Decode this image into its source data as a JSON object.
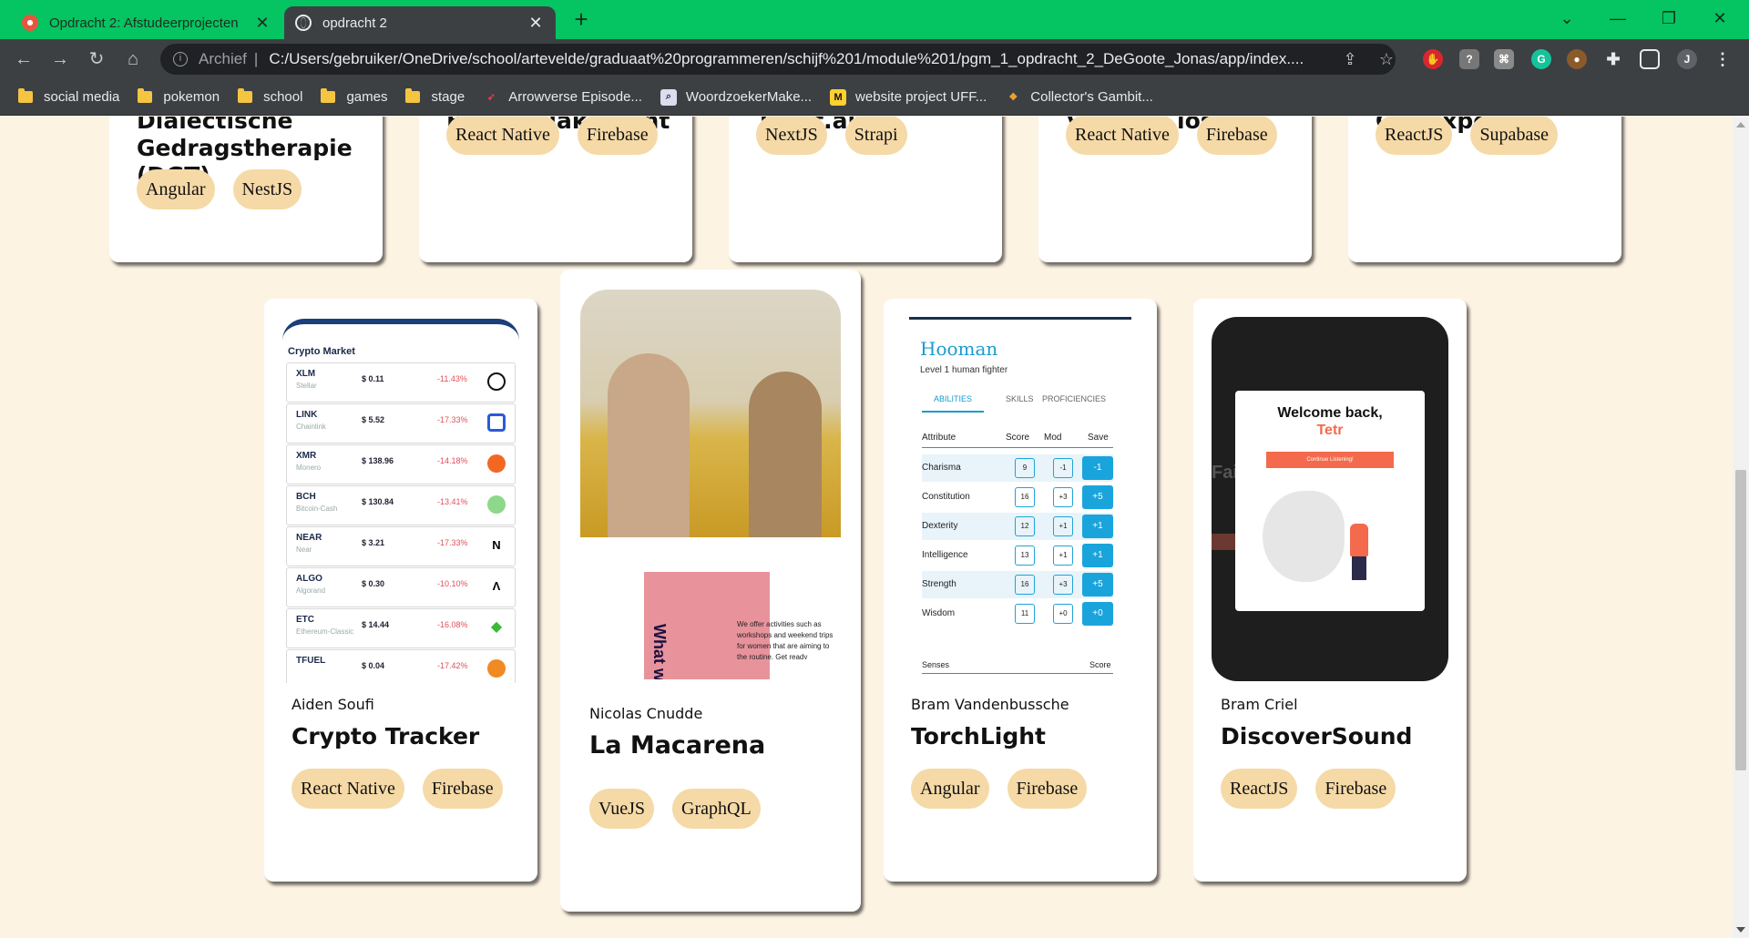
{
  "browser": {
    "tabs": [
      {
        "title": "Opdracht 2: Afstudeerprojecten",
        "active": false
      },
      {
        "title": "opdracht 2",
        "active": true
      }
    ],
    "address": {
      "label": "Archief",
      "url": "C:/Users/gebruiker/OneDrive/school/artevelde/graduaat%20programmeren/schijf%201/module%201/pgm_1_opdracht_2_DeGoote_Jonas/app/index...."
    },
    "profile_initial": "J",
    "bookmarks": [
      {
        "label": "social media",
        "icon": "folder-icon"
      },
      {
        "label": "pokemon",
        "icon": "folder-icon"
      },
      {
        "label": "school",
        "icon": "folder-icon"
      },
      {
        "label": "games",
        "icon": "folder-icon"
      },
      {
        "label": "stage",
        "icon": "folder-icon"
      },
      {
        "label": "Arrowverse Episode...",
        "icon": "arrowverse-icon"
      },
      {
        "label": "WoordzoekerMake...",
        "icon": "magnifier-icon"
      },
      {
        "label": "website project UFF...",
        "icon": "miro-icon"
      },
      {
        "label": "Collector's Gambit...",
        "icon": "collector-icon"
      }
    ]
  },
  "top_cards": [
    {
      "title": "Dialectische Gedragstherapie (DGT)",
      "tags": [
        "Angular",
        "NestJS"
      ]
    },
    {
      "title": "Buurtkajaks Gent",
      "tags": [
        "React Native",
        "Firebase"
      ]
    },
    {
      "title": "Tekst.ai",
      "tags": [
        "NextJS",
        "Strapi"
      ]
    },
    {
      "title": "Virtual Closet",
      "tags": [
        "React Native",
        "Firebase"
      ]
    },
    {
      "title": "Car expense",
      "tags": [
        "ReactJS",
        "Supabase"
      ]
    }
  ],
  "bottom_cards": [
    {
      "author": "Aiden Soufi",
      "title": "Crypto Tracker",
      "tags": [
        "React Native",
        "Firebase"
      ]
    },
    {
      "author": "Nicolas Cnudde",
      "title": "La Macarena",
      "tags": [
        "VueJS",
        "GraphQL"
      ]
    },
    {
      "author": "Bram Vandenbussche",
      "title": "TorchLight",
      "tags": [
        "Angular",
        "Firebase"
      ]
    },
    {
      "author": "Bram Criel",
      "title": "DiscoverSound",
      "tags": [
        "ReactJS",
        "Firebase"
      ]
    }
  ],
  "crypto": {
    "header": "Crypto Market",
    "rows": [
      {
        "sym": "XLM",
        "name": "Stellar",
        "price": "$ 0.11",
        "change": "-11.43%",
        "color": "#111111"
      },
      {
        "sym": "LINK",
        "name": "Chainlink",
        "price": "$ 5.52",
        "change": "-17.33%",
        "color": "#2a5ada"
      },
      {
        "sym": "XMR",
        "name": "Monero",
        "price": "$ 138.96",
        "change": "-14.18%",
        "color": "#f26822"
      },
      {
        "sym": "BCH",
        "name": "Bitcoin-Cash",
        "price": "$ 130.84",
        "change": "-13.41%",
        "color": "#4cc947"
      },
      {
        "sym": "NEAR",
        "name": "Near",
        "price": "$ 3.21",
        "change": "-17.33%",
        "color": "#111111"
      },
      {
        "sym": "ALGO",
        "name": "Algorand",
        "price": "$ 0.30",
        "change": "-10.10%",
        "color": "#111111"
      },
      {
        "sym": "ETC",
        "name": "Ethereum-Classic",
        "price": "$ 14.44",
        "change": "-16.08%",
        "color": "#3ab83a"
      },
      {
        "sym": "TFUEL",
        "name": "",
        "price": "$ 0.04",
        "change": "-17.42%",
        "color": "#f08a24"
      }
    ]
  },
  "macarena": {
    "vertical_text": "What w",
    "body": "We offer activities such as workshops and weekend trips for women that are aiming to the routine. Get ready"
  },
  "hooman": {
    "name": "Hooman",
    "subtitle": "Level 1 human fighter",
    "tabs": [
      "ABILITIES",
      "SKILLS",
      "PROFICIENCIES"
    ],
    "headers": [
      "Attribute",
      "Score",
      "Mod",
      "Save"
    ],
    "rows": [
      {
        "attr": "Charisma",
        "score": "9",
        "mod": "-1",
        "save": "-1"
      },
      {
        "attr": "Constitution",
        "score": "16",
        "mod": "+3",
        "save": "+5"
      },
      {
        "attr": "Dexterity",
        "score": "12",
        "mod": "+1",
        "save": "+1"
      },
      {
        "attr": "Intelligence",
        "score": "13",
        "mod": "+1",
        "save": "+1"
      },
      {
        "attr": "Strength",
        "score": "16",
        "mod": "+3",
        "save": "+5"
      },
      {
        "attr": "Wisdom",
        "score": "11",
        "mod": "+0",
        "save": "+0"
      }
    ],
    "senses": "Senses",
    "senses_score": "Score"
  },
  "discover": {
    "welcome": "Welcome back,",
    "user": "Tetr",
    "button": "Continue Listening!",
    "side_text": "Fai"
  }
}
